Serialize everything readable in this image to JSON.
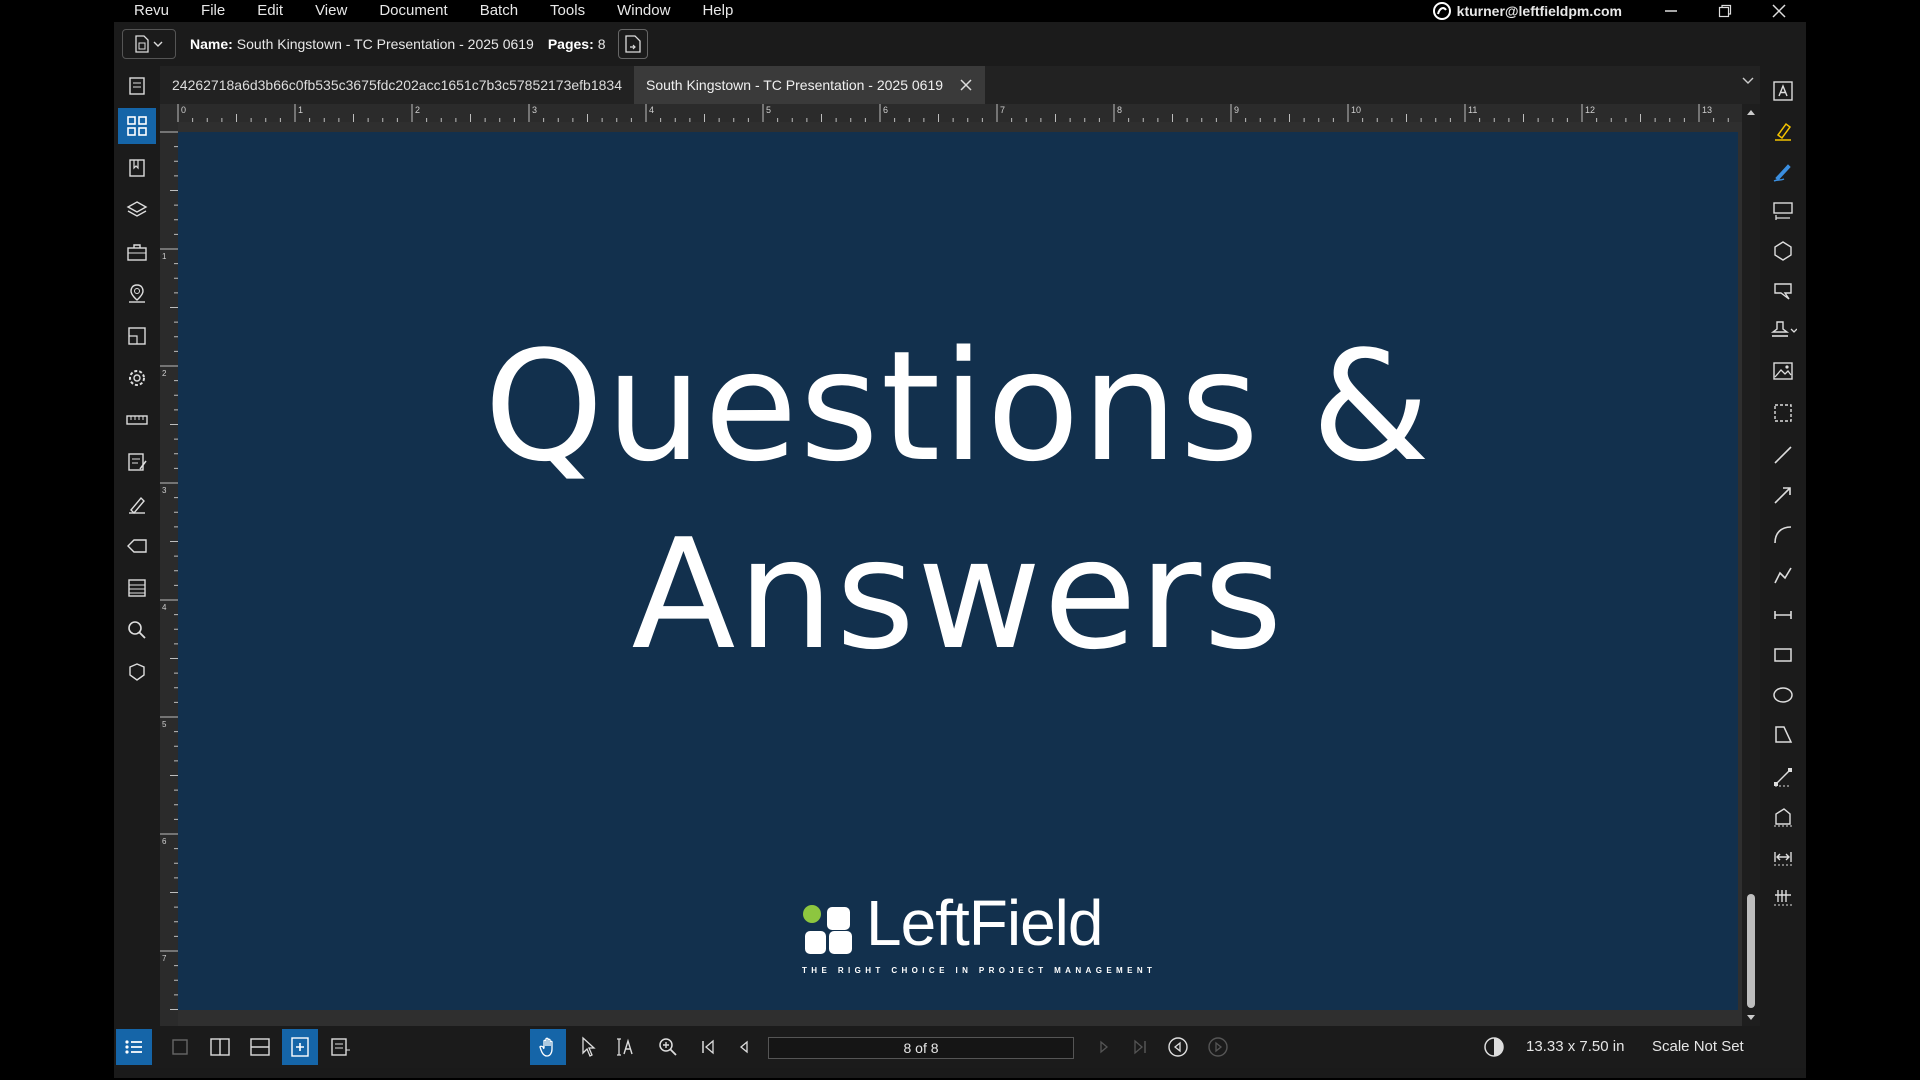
{
  "menubar": {
    "items": [
      "Revu",
      "File",
      "Edit",
      "View",
      "Document",
      "Batch",
      "Tools",
      "Window",
      "Help"
    ],
    "user_email": "kturner@leftfieldpm.com"
  },
  "docbar": {
    "name_label": "Name:",
    "name_value": "South Kingstown - TC Presentation - 2025 0619",
    "pages_label": "Pages:",
    "pages_value": "8"
  },
  "tabs": [
    {
      "label": "24262718a6d3b66c0fb535c3675fdc202acc1651c7b3c57852173efb1834",
      "active": false
    },
    {
      "label": "South Kingstown - TC Presentation - 2025 0619",
      "active": true
    }
  ],
  "ruler_numbers": [
    "0",
    "1",
    "2",
    "3",
    "4",
    "5",
    "6",
    "7",
    "8",
    "9",
    "10",
    "11",
    "12",
    "13"
  ],
  "vruler_numbers": [
    "1",
    "2",
    "3",
    "4",
    "5",
    "6",
    "7"
  ],
  "slide": {
    "title_line1": "Questions &",
    "title_line2": "Answers",
    "logo_wordmark": "LeftField",
    "logo_tagline": "THE RIGHT CHOICE IN PROJECT MANAGEMENT",
    "background_color": "#12304d",
    "logo_accent_color": "#8dc63f"
  },
  "statusbar": {
    "page_indicator": "8 of 8",
    "dimensions": "13.33 x 7.50 in",
    "scale": "Scale Not Set"
  },
  "colors": {
    "accent": "#1565a8",
    "chrome_bg": "#1b1b1b"
  }
}
